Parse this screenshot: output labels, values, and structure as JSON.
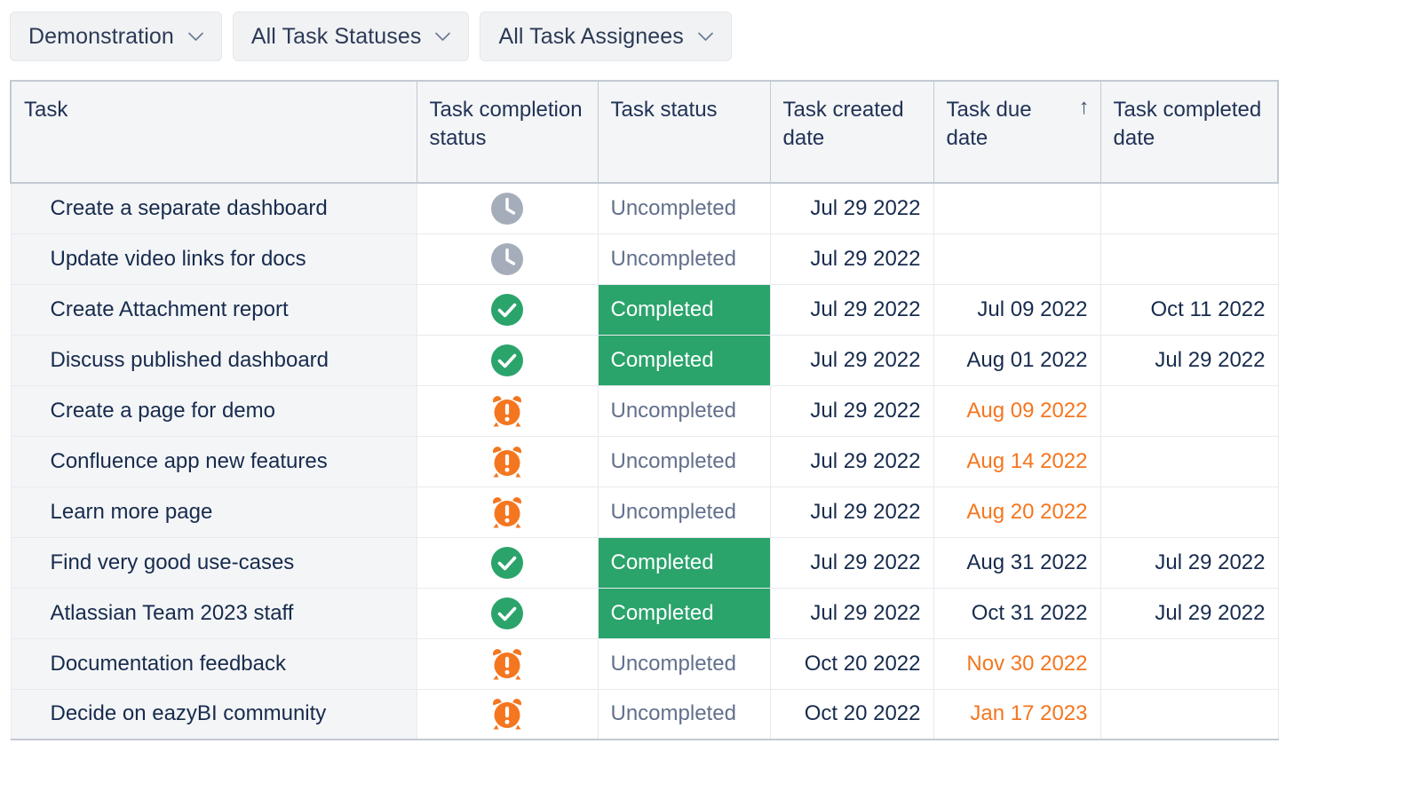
{
  "filters": [
    {
      "label": "Demonstration",
      "icon": "chevron-down-icon"
    },
    {
      "label": "All Task Statuses",
      "icon": "chevron-down-icon"
    },
    {
      "label": "All Task Assignees",
      "icon": "chevron-down-icon"
    }
  ],
  "table": {
    "columns": [
      {
        "key": "task",
        "label": "Task",
        "sorted": false
      },
      {
        "key": "completion",
        "label": "Task completion status",
        "sorted": false
      },
      {
        "key": "status",
        "label": "Task status",
        "sorted": false
      },
      {
        "key": "created",
        "label": "Task created date",
        "sorted": false
      },
      {
        "key": "due",
        "label": "Task due date",
        "sorted": true,
        "sort_indicator": "↑"
      },
      {
        "key": "completed",
        "label": "Task completed date",
        "sorted": false
      }
    ],
    "rows": [
      {
        "task": "Create a separate dashboard",
        "completion_icon": "clock-icon",
        "status": "Uncompleted",
        "created": "Jul 29 2022",
        "due": "",
        "due_overdue": false,
        "completed": ""
      },
      {
        "task": "Update video links for docs",
        "completion_icon": "clock-icon",
        "status": "Uncompleted",
        "created": "Jul 29 2022",
        "due": "",
        "due_overdue": false,
        "completed": ""
      },
      {
        "task": "Create Attachment report",
        "completion_icon": "check-circle-icon",
        "status": "Completed",
        "created": "Jul 29 2022",
        "due": "Jul 09 2022",
        "due_overdue": false,
        "completed": "Oct 11 2022"
      },
      {
        "task": "Discuss published dashboard",
        "completion_icon": "check-circle-icon",
        "status": "Completed",
        "created": "Jul 29 2022",
        "due": "Aug 01 2022",
        "due_overdue": false,
        "completed": "Jul 29 2022"
      },
      {
        "task": "Create a page for demo",
        "completion_icon": "alarm-warning-icon",
        "status": "Uncompleted",
        "created": "Jul 29 2022",
        "due": "Aug 09 2022",
        "due_overdue": true,
        "completed": ""
      },
      {
        "task": "Confluence app new features",
        "completion_icon": "alarm-warning-icon",
        "status": "Uncompleted",
        "created": "Jul 29 2022",
        "due": "Aug 14 2022",
        "due_overdue": true,
        "completed": ""
      },
      {
        "task": "Learn more page",
        "completion_icon": "alarm-warning-icon",
        "status": "Uncompleted",
        "created": "Jul 29 2022",
        "due": "Aug 20 2022",
        "due_overdue": true,
        "completed": ""
      },
      {
        "task": "Find very good use-cases",
        "completion_icon": "check-circle-icon",
        "status": "Completed",
        "created": "Jul 29 2022",
        "due": "Aug 31 2022",
        "due_overdue": false,
        "completed": "Jul 29 2022"
      },
      {
        "task": "Atlassian Team 2023 staff",
        "completion_icon": "check-circle-icon",
        "status": "Completed",
        "created": "Jul 29 2022",
        "due": "Oct 31 2022",
        "due_overdue": false,
        "completed": "Jul 29 2022"
      },
      {
        "task": "Documentation feedback",
        "completion_icon": "alarm-warning-icon",
        "status": "Uncompleted",
        "created": "Oct 20 2022",
        "due": "Nov 30 2022",
        "due_overdue": true,
        "completed": ""
      },
      {
        "task": "Decide on eazyBI community",
        "completion_icon": "alarm-warning-icon",
        "status": "Uncompleted",
        "created": "Oct 20 2022",
        "due": "Jan 17 2023",
        "due_overdue": true,
        "completed": ""
      }
    ]
  },
  "colors": {
    "completed_green": "#2aa46b",
    "overdue_orange": "#f4761f",
    "clock_gray": "#a5adba",
    "text_navy": "#1f3155",
    "uncompleted_gray": "#62708c",
    "header_bg": "#f4f5f7",
    "filter_bg": "#f1f2f4"
  }
}
